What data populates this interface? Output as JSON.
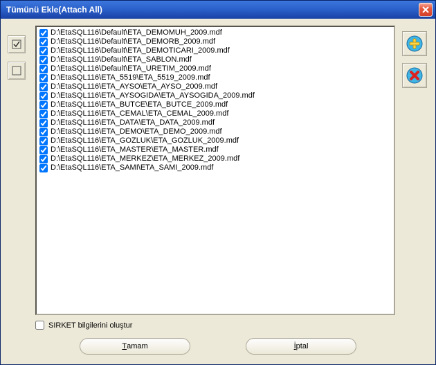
{
  "window": {
    "title": "Tümünü Ekle(Attach All)"
  },
  "files": [
    "D:\\EtaSQL116\\Default\\ETA_DEMOMUH_2009.mdf",
    "D:\\EtaSQL116\\Default\\ETA_DEMORB_2009.mdf",
    "D:\\EtaSQL116\\Default\\ETA_DEMOTICARI_2009.mdf",
    "D:\\EtaSQL119\\Default\\ETA_SABLON.mdf",
    "D:\\EtaSQL116\\Default\\ETA_URETIM_2009.mdf",
    "D:\\EtaSQL116\\ETA_5519\\ETA_5519_2009.mdf",
    "D:\\EtaSQL116\\ETA_AYSO\\ETA_AYSO_2009.mdf",
    "D:\\EtaSQL116\\ETA_AYSOGIDA\\ETA_AYSOGIDA_2009.mdf",
    "D:\\EtaSQL116\\ETA_BUTCE\\ETA_BUTCE_2009.mdf",
    "D:\\EtaSQL116\\ETA_CEMAL\\ETA_CEMAL_2009.mdf",
    "D:\\EtaSQL116\\ETA_DATA\\ETA_DATA_2009.mdf",
    "D:\\EtaSQL116\\ETA_DEMO\\ETA_DEMO_2009.mdf",
    "D:\\EtaSQL116\\ETA_GOZLUK\\ETA_GOZLUK_2009.mdf",
    "D:\\EtaSQL116\\ETA_MASTER\\ETA_MASTER.mdf",
    "D:\\EtaSQL116\\ETA_MERKEZ\\ETA_MERKEZ_2009.mdf",
    "D:\\EtaSQL116\\ETA_SAMI\\ETA_SAMI_2009.mdf"
  ],
  "bottom": {
    "create_sirket_label": "SIRKET bilgilerini oluştur"
  },
  "buttons": {
    "ok_prefix": "T",
    "ok_rest": "amam",
    "cancel_prefix": "İ",
    "cancel_rest": "ptal"
  }
}
